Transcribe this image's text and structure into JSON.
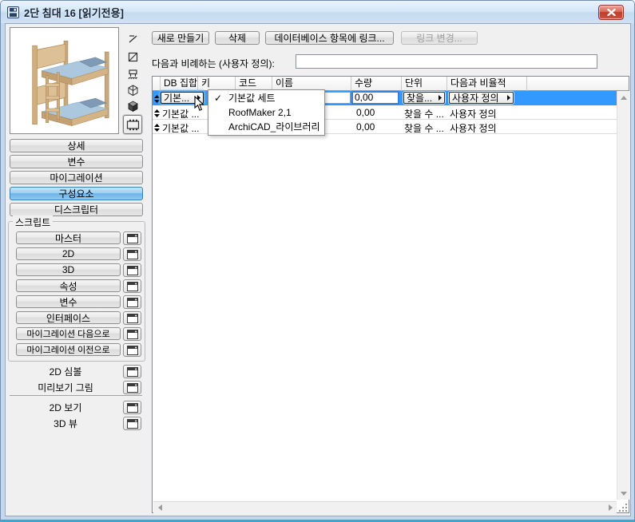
{
  "window": {
    "title": "2단 침대 16 [읽기전용]"
  },
  "toolbar": {
    "new": "새로 만들기",
    "delete": "삭제",
    "link_db": "데이터베이스 항목에 링크...",
    "change_link": "링크 변경..."
  },
  "proportion": {
    "label": "다음과 비례하는 (사용자 정의):",
    "value": ""
  },
  "sidebar": {
    "detail": "상세",
    "params": "변수",
    "migration": "마이그레이션",
    "components": "구성요소",
    "descriptor": "디스크립터",
    "script_label": "스크립트",
    "scripts": [
      "마스터",
      "2D",
      "3D",
      "속성",
      "변수",
      "인터페이스",
      "마이그레이션 다음으로",
      "마이그레이션 이전으로"
    ],
    "symbol_2d": "2D 심볼",
    "preview_pic": "미리보기 그림",
    "view_2d": "2D 보기",
    "view_3d": "3D 뷰"
  },
  "table": {
    "headers": [
      "DB 집합",
      "키",
      "코드",
      "이름",
      "수량",
      "단위",
      "다음과 비율적"
    ],
    "row1": {
      "db": "기본...",
      "qty": "0,00",
      "unit": "찾을...",
      "prop": "사용자 정의"
    },
    "row2": {
      "db": "기본값 ...",
      "qty": "0,00",
      "unit": "찾을 수 ...",
      "prop": "사용자 정의"
    },
    "row3": {
      "db": "기본값 ...",
      "qty": "0,00",
      "unit": "찾을 수 ...",
      "prop": "사용자 정의"
    }
  },
  "menu": {
    "check": "✓",
    "items": [
      "기본값 세트",
      "RoofMaker 2,1",
      "ArchiCAD_라이브러리"
    ]
  },
  "colors": {
    "selection": "#3399ff",
    "frame": "#c3d8ef",
    "selected_button": "#6fb4e8",
    "close_button": "#c13b2a"
  }
}
